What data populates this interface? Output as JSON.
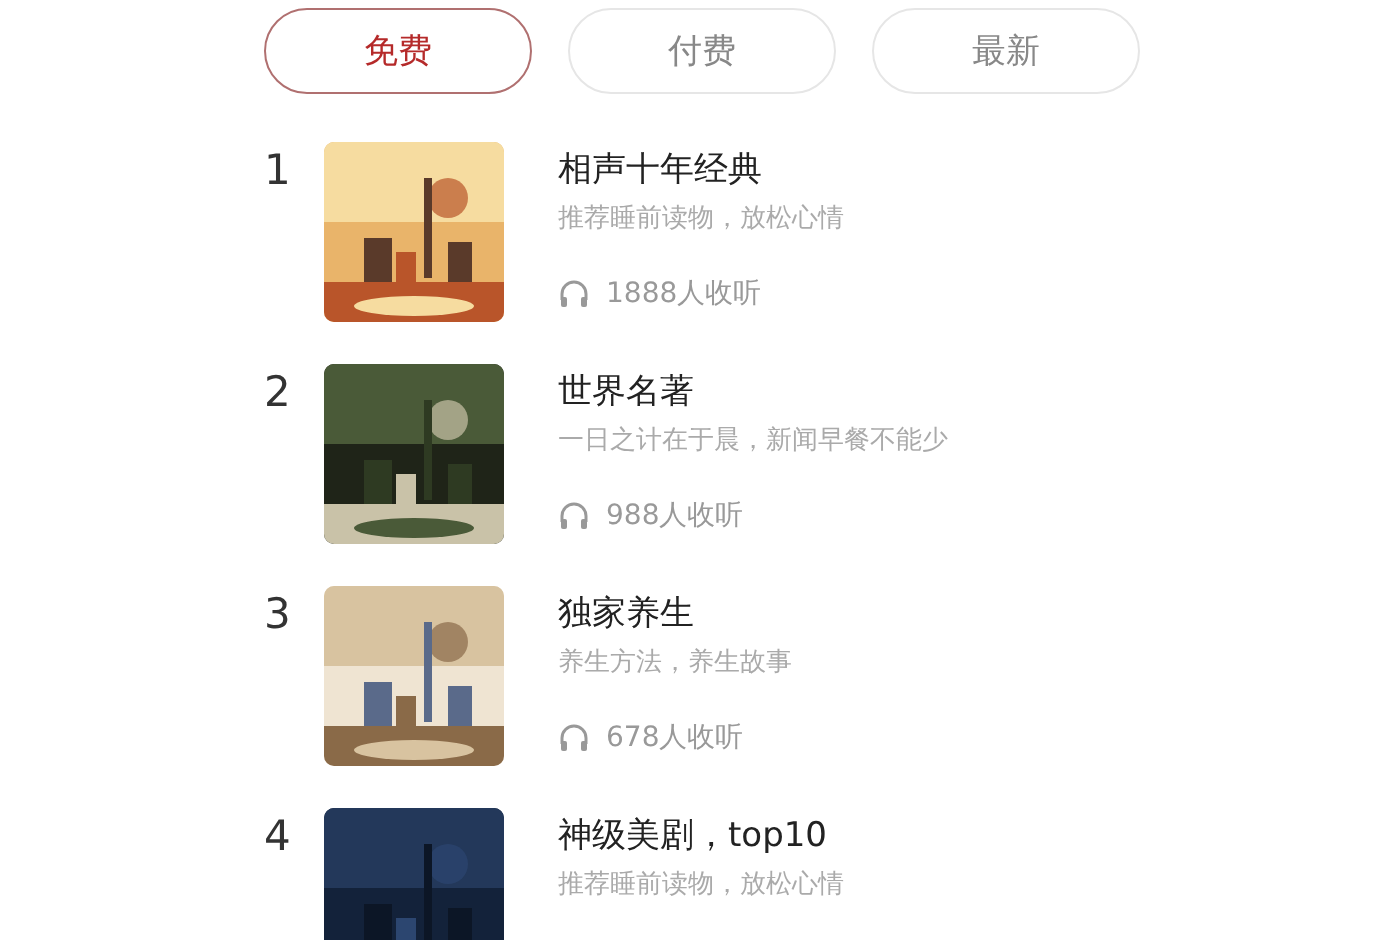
{
  "tabs": [
    {
      "label": "免费",
      "selected": true
    },
    {
      "label": "付费",
      "selected": false
    },
    {
      "label": "最新",
      "selected": false
    }
  ],
  "programs": [
    {
      "rank": "1",
      "title": "相声十年经典",
      "subtitle": "推荐睡前读物，放松心情",
      "listeners": "1888人收听"
    },
    {
      "rank": "2",
      "title": "世界名著",
      "subtitle": "一日之计在于晨，新闻早餐不能少",
      "listeners": "988人收听"
    },
    {
      "rank": "3",
      "title": "独家养生",
      "subtitle": "养生方法，养生故事",
      "listeners": "678人收听"
    },
    {
      "rank": "4",
      "title": "神级美剧，top10",
      "subtitle": "推荐睡前读物，放松心情"
    }
  ]
}
